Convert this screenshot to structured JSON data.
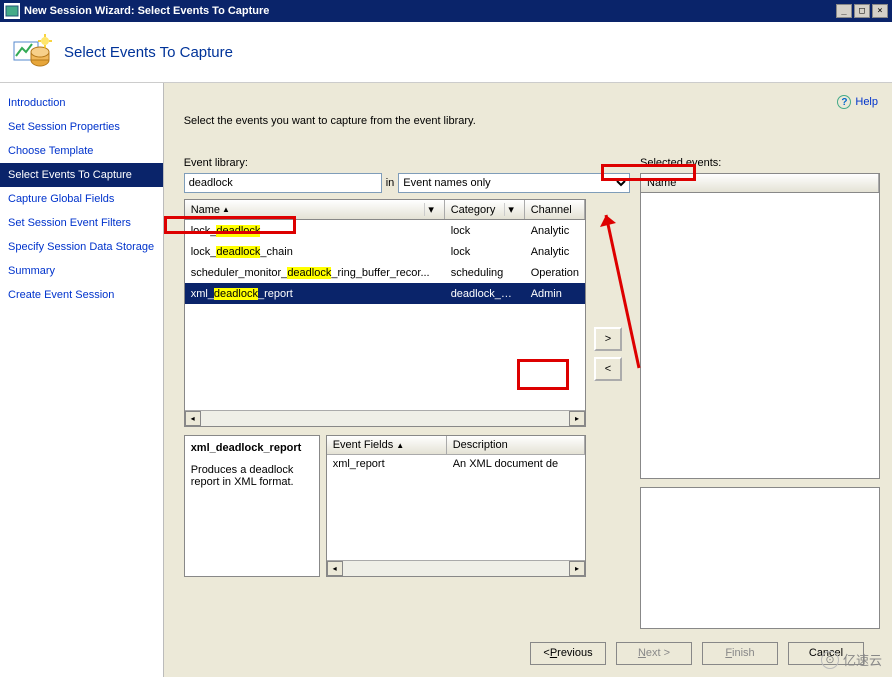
{
  "window": {
    "title": "New Session Wizard: Select Events To Capture",
    "min_btn": "_",
    "max_btn": "□",
    "close_btn": "×"
  },
  "header": {
    "title": "Select Events To Capture"
  },
  "help_label": "Help",
  "sidebar": {
    "items": [
      {
        "label": "Introduction",
        "selected": false
      },
      {
        "label": "Set Session Properties",
        "selected": false
      },
      {
        "label": "Choose Template",
        "selected": false
      },
      {
        "label": "Select Events To Capture",
        "selected": true
      },
      {
        "label": "Capture Global Fields",
        "selected": false
      },
      {
        "label": "Set Session Event Filters",
        "selected": false
      },
      {
        "label": "Specify Session Data Storage",
        "selected": false
      },
      {
        "label": "Summary",
        "selected": false
      },
      {
        "label": "Create Event Session",
        "selected": false
      }
    ]
  },
  "instruction": "Select the events you want to capture from the event library.",
  "event_library": {
    "label": "Event library:",
    "search_value": "deadlock",
    "in_label": "in",
    "scope": "Event names only",
    "columns": {
      "name": "Name",
      "category": "Category",
      "channel": "Channel"
    },
    "rows": [
      {
        "name_pre": "lock_",
        "name_hi": "deadlock",
        "name_post": "",
        "category": "lock",
        "channel": "Analytic",
        "selected": false
      },
      {
        "name_pre": "lock_",
        "name_hi": "deadlock",
        "name_post": "_chain",
        "category": "lock",
        "channel": "Analytic",
        "selected": false
      },
      {
        "name_pre": "scheduler_monitor_",
        "name_hi": "deadlock",
        "name_post": "_ring_buffer_recor...",
        "category": "scheduling",
        "channel": "Operation",
        "selected": false
      },
      {
        "name_pre": "xml_",
        "name_hi": "deadlock",
        "name_post": "_report",
        "category": "deadlock_mo...",
        "channel": "Admin",
        "selected": true
      }
    ]
  },
  "transfer": {
    "add": ">",
    "remove": "<"
  },
  "selected_events": {
    "label": "Selected events:",
    "column": "Name"
  },
  "detail": {
    "title": "xml_deadlock_report",
    "description": "Produces a deadlock report in XML format.",
    "fields_label": "Event Fields",
    "desc_label": "Description",
    "fields": [
      {
        "name": "xml_report",
        "desc": "An XML document de"
      }
    ]
  },
  "buttons": {
    "previous_pre": "< ",
    "previous_ul": "P",
    "previous_post": "revious",
    "next_ul": "N",
    "next_post": "ext >",
    "finish_ul": "F",
    "finish_post": "inish",
    "cancel": "Cancel"
  },
  "watermark": "亿速云"
}
